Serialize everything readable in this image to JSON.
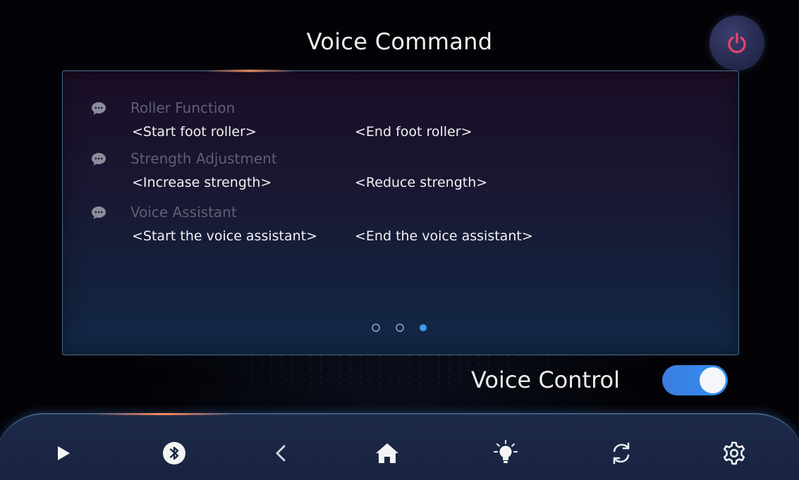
{
  "header": {
    "title": "Voice Command",
    "power_icon": "power-icon",
    "power_color": "#e8446a"
  },
  "commands": {
    "groups": [
      {
        "icon": "chat-bubble-icon",
        "title": "Roller Function",
        "commands": [
          "<Start foot roller>",
          "<End foot roller>"
        ]
      },
      {
        "icon": "chat-bubble-icon",
        "title": "Strength Adjustment",
        "commands": [
          "<Increase strength>",
          "<Reduce strength>"
        ]
      },
      {
        "icon": "chat-bubble-icon",
        "title": "Voice Assistant",
        "commands": [
          "<Start the voice assistant>",
          "<End the voice assistant>"
        ]
      }
    ],
    "pager": {
      "pages": 3,
      "active_page": 3
    }
  },
  "voice_control": {
    "label": "Voice Control",
    "enabled": true,
    "toggle_color": "#3487ea"
  },
  "nav": {
    "items": [
      {
        "icon": "play-icon"
      },
      {
        "icon": "bluetooth-icon"
      },
      {
        "icon": "back-chevron-icon"
      },
      {
        "icon": "home-icon"
      },
      {
        "icon": "lightbulb-icon"
      },
      {
        "icon": "sync-icon"
      },
      {
        "icon": "settings-gear-icon"
      }
    ]
  },
  "colors": {
    "background": "#030307",
    "panel_border": "#4a6f8f",
    "accent_blue": "#3d9bec",
    "muted_text": "#5f5f74"
  }
}
